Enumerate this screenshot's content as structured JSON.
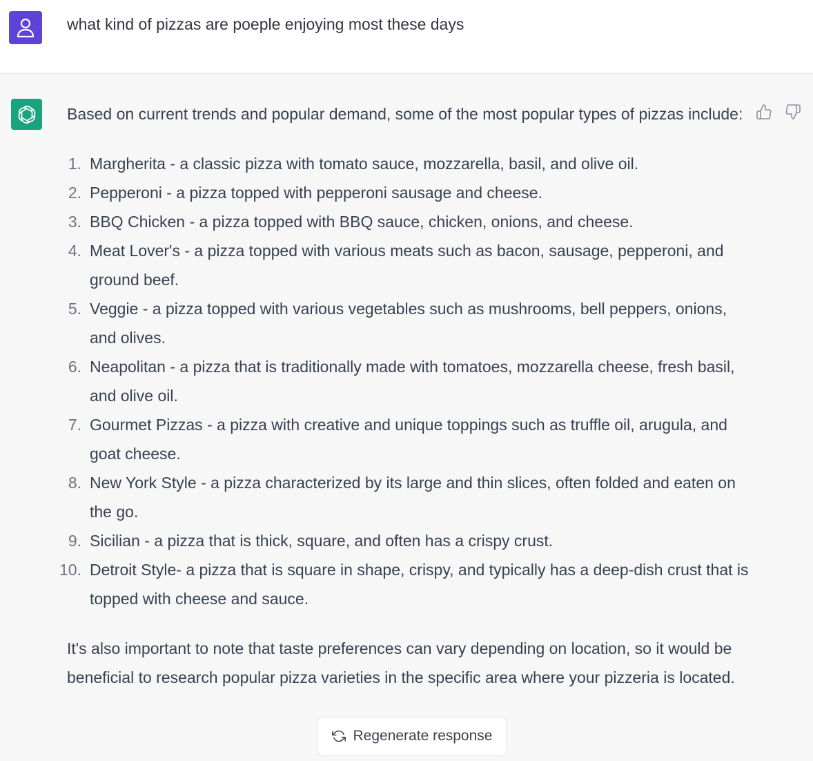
{
  "user_message": {
    "avatar_icon": "user-icon",
    "avatar_color": "#5e43d8",
    "text": "what kind of pizzas are poeple enjoying most these days"
  },
  "assistant_message": {
    "avatar_icon": "openai-logo-icon",
    "avatar_color": "#19a37f",
    "intro": "Based on current trends and popular demand, some of the most popular types of pizzas include:",
    "items": [
      {
        "num": "1.",
        "text": "Margherita - a classic pizza with tomato sauce, mozzarella, basil, and olive oil."
      },
      {
        "num": "2.",
        "text": "Pepperoni - a pizza topped with pepperoni sausage and cheese."
      },
      {
        "num": "3.",
        "text": "BBQ Chicken - a pizza topped with BBQ sauce, chicken, onions, and cheese."
      },
      {
        "num": "4.",
        "text": "Meat Lover's - a pizza topped with various meats such as bacon, sausage, pepperoni, and ground beef."
      },
      {
        "num": "5.",
        "text": "Veggie - a pizza topped with various vegetables such as mushrooms, bell peppers, onions, and olives."
      },
      {
        "num": "6.",
        "text": "Neapolitan - a pizza that is traditionally made with tomatoes, mozzarella cheese, fresh basil, and olive oil."
      },
      {
        "num": "7.",
        "text": "Gourmet Pizzas - a pizza with creative and unique toppings such as truffle oil, arugula, and goat cheese."
      },
      {
        "num": "8.",
        "text": "New York Style - a pizza characterized by its large and thin slices, often folded and eaten on the go."
      },
      {
        "num": "9.",
        "text": "Sicilian - a pizza that is thick, square, and often has a crispy crust."
      },
      {
        "num": "10.",
        "text": "Detroit Style- a pizza that is square in shape, crispy, and typically has a deep-dish crust that is topped with cheese and sauce."
      }
    ],
    "outro": "It's also important to note that taste preferences can vary depending on location, so it would be beneficial to research popular pizza varieties in the specific area where your pizzeria is located."
  },
  "feedback": {
    "thumbs_up_icon": "thumbs-up-icon",
    "thumbs_down_icon": "thumbs-down-icon"
  },
  "regenerate_button": {
    "icon": "refresh-icon",
    "label": "Regenerate response"
  }
}
